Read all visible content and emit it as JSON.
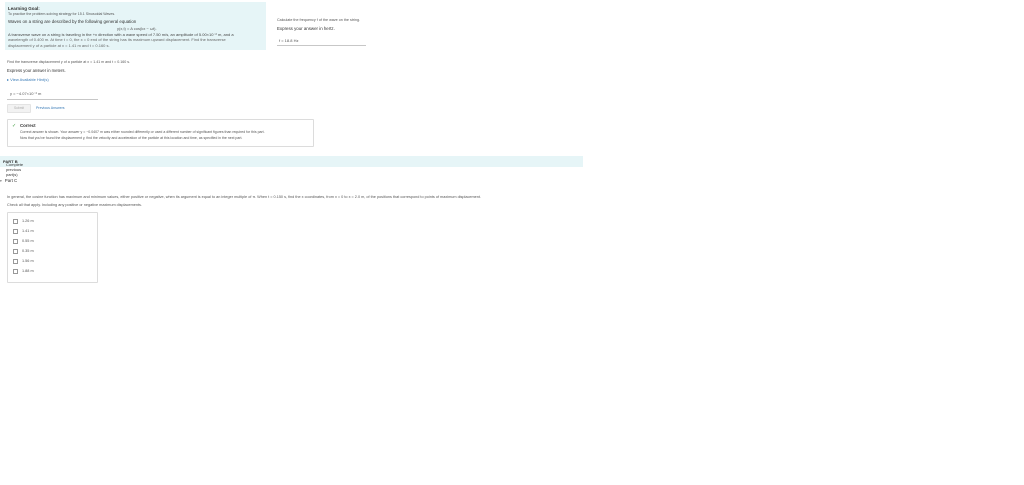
{
  "learning_goal": {
    "title": "Learning Goal:",
    "subtitle": "To practice the problem-solving strategy for 15.1 Sinusoidal Waves.",
    "intro": "Waves on a string are described by the following general equation",
    "equation": "y(x,t) = A cos(kx − ωt).",
    "text_line1": "A transverse wave on a string is traveling in the +x direction with a wave speed of 7.50 m/s, an amplitude of 5.00×10⁻² m, and a",
    "text_line2": "wavelength of 0.400 m. At time t = 0, the x = 0 end of the string has its maximum upward displacement. Find the transverse",
    "text_line3": "displacement y of a particle at x = 1.41 m and t = 0.160 s."
  },
  "right_panel": {
    "question": "Calculate the frequency f of the wave on the string.",
    "express": "Express your answer in hertz.",
    "answer": "f = 18.8 Hz"
  },
  "part_a": {
    "question": "Find the transverse displacement y of a particle at x = 1.41 m and t = 0.160 s.",
    "express": "Express your answer in meters.",
    "hints_link": "View Available Hint(s)",
    "answer": "y = −4.07×10⁻² m",
    "submit_label": "Submit",
    "previous_label": "Previous Answers"
  },
  "correct": {
    "check": "✓",
    "title": "Correct",
    "msg1": "Correct answer is shown. Your answer y = −0.0407 m was either rounded differently or used a different number of significant figures than required for this part.",
    "msg2": "Now that you've found the displacement y, find the velocity and acceleration of the particle at this location and time, as specified in the next part."
  },
  "bar": {
    "label": "PART B",
    "text": "Complete previous part(s)"
  },
  "part_c": {
    "arrow": "▾",
    "title": "Part C",
    "q1": "In general, the cosine function has maximum and minimum values, either positive or negative, when its argument is equal to an integer multiple of π. When t = 0.150 s, find the x coordinates, from x = 0 to x = 2.0 m, of the positions that correspond to points of maximum displacement.",
    "q2": "Check all that apply. Including any positive or negative maximum displacements.",
    "options": [
      "1.26 m",
      "1.41 m",
      "0.55 m",
      "0.35 m",
      "1.56 m",
      "1.88 m"
    ]
  }
}
